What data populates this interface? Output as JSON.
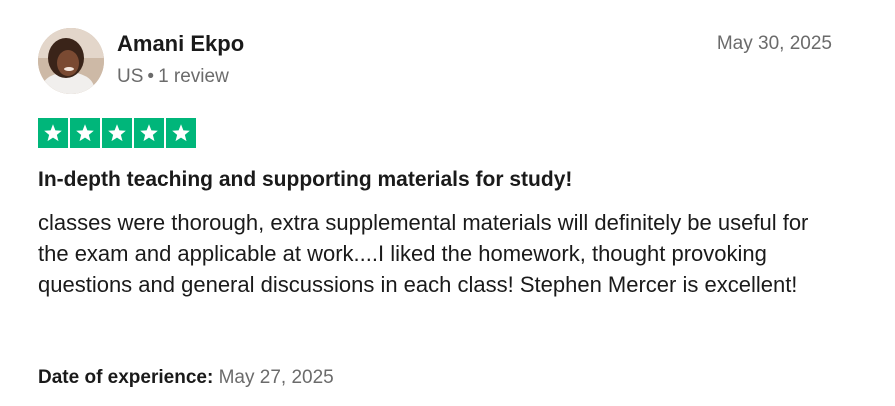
{
  "reviewer": {
    "name": "Amani Ekpo",
    "country": "US",
    "separator": "•",
    "review_count": "1 review",
    "avatar_icon": "profile-photo"
  },
  "review": {
    "date": "May 30, 2025",
    "rating": 5,
    "rating_max": 5,
    "star_color": "#00b67a",
    "title": "In-depth teaching and supporting materials for study!",
    "body": "classes were thorough, extra supplemental materials will definitely be useful for the exam and applicable at work....I liked the homework, thought provoking questions and general discussions in each class! Stephen Mercer is excellent!",
    "experience_label": "Date of experience:",
    "experience_date": "May 27, 2025"
  }
}
